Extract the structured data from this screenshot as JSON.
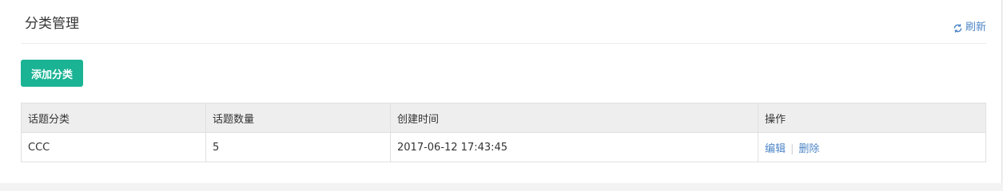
{
  "header": {
    "title": "分类管理",
    "refresh_label": "刷新"
  },
  "toolbar": {
    "add_label": "添加分类"
  },
  "table": {
    "columns": [
      "话题分类",
      "话题数量",
      "创建时间",
      "操作"
    ],
    "rows": [
      {
        "category": "CCC",
        "topic_count": "5",
        "created_at": "2017-06-12 17:43:45",
        "actions": {
          "edit": "编辑",
          "separator": "|",
          "delete": "删除"
        }
      }
    ]
  },
  "colors": {
    "primary": "#1ab394",
    "link": "#4d86c8",
    "header_bg": "#eeeeee"
  },
  "icons": {
    "refresh": "refresh-icon"
  }
}
